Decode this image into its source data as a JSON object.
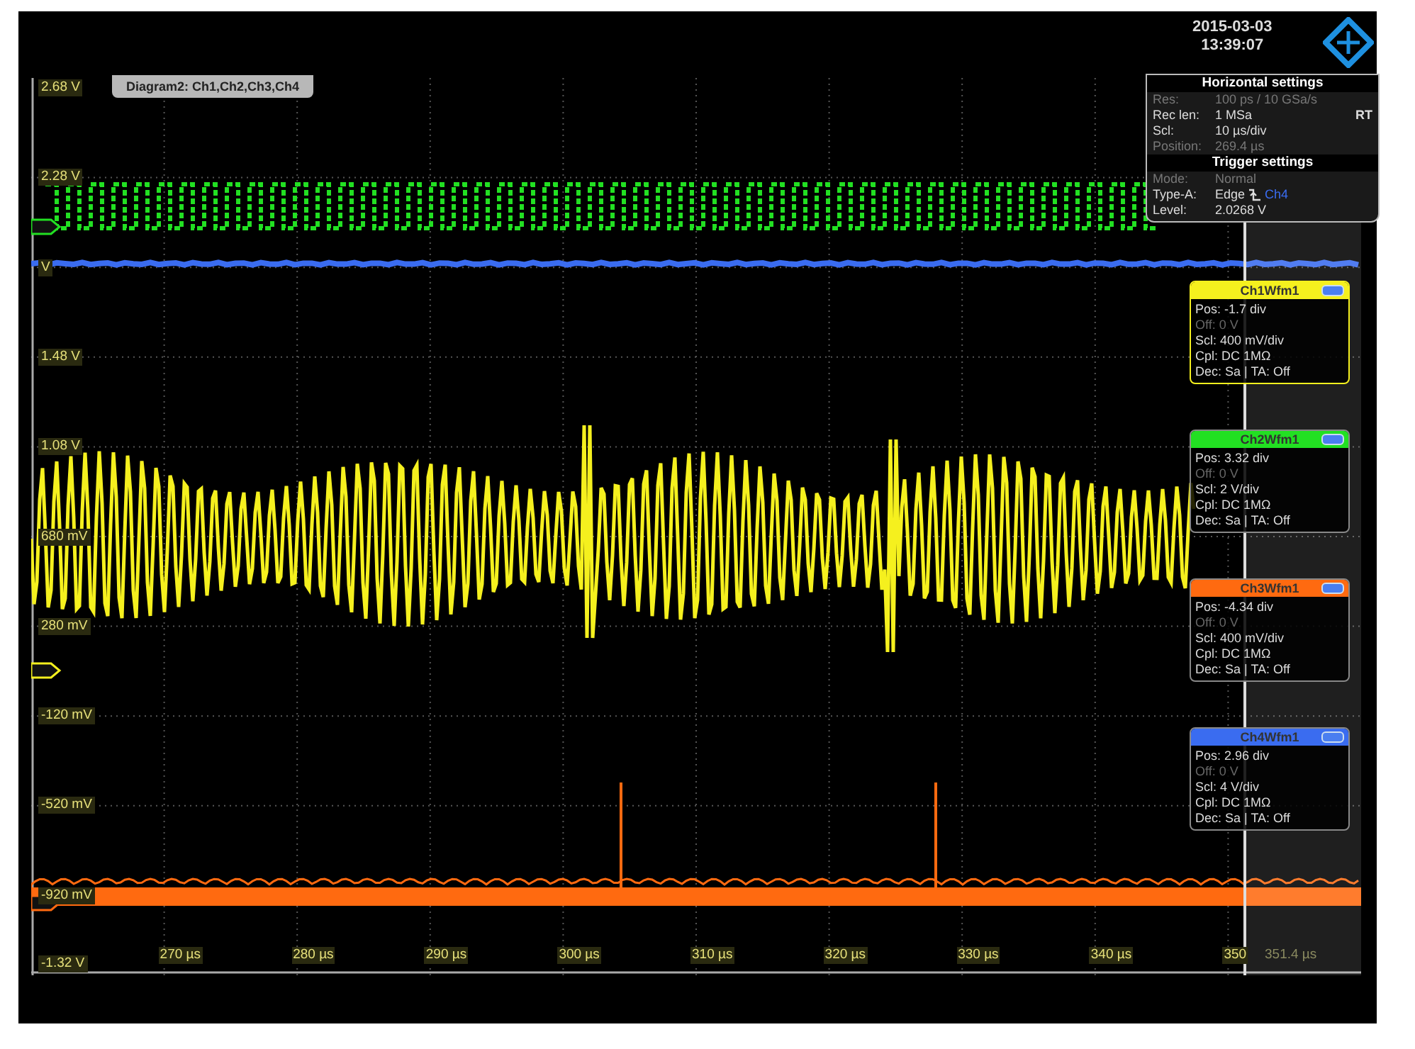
{
  "timestamp": {
    "date": "2015-03-03",
    "time": "13:39:07"
  },
  "diagram_label": "Diagram2: Ch1,Ch2,Ch3,Ch4",
  "y_axis_labels": [
    "2.68 V",
    "2.28 V",
    "V",
    "1.48 V",
    "1.08 V",
    "680 mV",
    "280 mV",
    "-120 mV",
    "-520 mV",
    "-920 mV",
    "-1.32 V"
  ],
  "x_axis_labels": [
    {
      "text": "270 µs",
      "dimmed": false
    },
    {
      "text": "280 µs",
      "dimmed": false
    },
    {
      "text": "290 µs",
      "dimmed": false
    },
    {
      "text": "300 µs",
      "dimmed": false
    },
    {
      "text": "310 µs",
      "dimmed": false
    },
    {
      "text": "320 µs",
      "dimmed": false
    },
    {
      "text": "330 µs",
      "dimmed": false
    },
    {
      "text": "340 µs",
      "dimmed": false
    },
    {
      "text": "350",
      "dimmed": false
    },
    {
      "text": "351.4 µs",
      "dimmed": true
    }
  ],
  "horizontal_settings": {
    "title": "Horizontal settings",
    "badge": "RT",
    "rows": [
      {
        "label": "Res:",
        "value": "100 ps / 10 GSa/s",
        "dimmed": true
      },
      {
        "label": "Rec len:",
        "value": "1 MSa",
        "dimmed": false
      },
      {
        "label": "Scl:",
        "value": "10 µs/div",
        "dimmed": false
      },
      {
        "label": "Position:",
        "value": "269.4 µs",
        "dimmed": true
      }
    ]
  },
  "trigger_settings": {
    "title": "Trigger settings",
    "rows": [
      {
        "label": "Mode:",
        "value": "Normal",
        "dimmed": true
      },
      {
        "label": "Type-A:",
        "value": "Edge",
        "source": "Ch4",
        "dimmed": false
      },
      {
        "label": "Level:",
        "value": "2.0268 V",
        "dimmed": false
      }
    ]
  },
  "channels": [
    {
      "name": "Ch1Wfm1",
      "color": "#f5f01e",
      "rows": [
        {
          "label": "Pos:",
          "value": "-1.7 div",
          "dimmed": false
        },
        {
          "label": "Off:",
          "value": "0 V",
          "dimmed": true
        },
        {
          "label": "Scl:",
          "value": "400 mV/div",
          "dimmed": false
        },
        {
          "label": "Cpl:",
          "value": "DC 1MΩ",
          "dimmed": false
        },
        {
          "label": "Dec:",
          "value": "Sa | TA: Off",
          "dimmed": false
        }
      ]
    },
    {
      "name": "Ch2Wfm1",
      "color": "#22e022",
      "rows": [
        {
          "label": "Pos:",
          "value": "3.32 div",
          "dimmed": false
        },
        {
          "label": "Off:",
          "value": "0 V",
          "dimmed": true
        },
        {
          "label": "Scl:",
          "value": "2 V/div",
          "dimmed": false
        },
        {
          "label": "Cpl:",
          "value": "DC 1MΩ",
          "dimmed": false
        },
        {
          "label": "Dec:",
          "value": "Sa | TA: Off",
          "dimmed": false
        }
      ]
    },
    {
      "name": "Ch3Wfm1",
      "color": "#ff6a10",
      "rows": [
        {
          "label": "Pos:",
          "value": "-4.34 div",
          "dimmed": false
        },
        {
          "label": "Off:",
          "value": "0 V",
          "dimmed": true
        },
        {
          "label": "Scl:",
          "value": "400 mV/div",
          "dimmed": false
        },
        {
          "label": "Cpl:",
          "value": "DC 1MΩ",
          "dimmed": false
        },
        {
          "label": "Dec:",
          "value": "Sa | TA: Off",
          "dimmed": false
        }
      ]
    },
    {
      "name": "Ch4Wfm1",
      "color": "#3a6cf0",
      "rows": [
        {
          "label": "Pos:",
          "value": "2.96 div",
          "dimmed": false
        },
        {
          "label": "Off:",
          "value": "0 V",
          "dimmed": true
        },
        {
          "label": "Scl:",
          "value": "4 V/div",
          "dimmed": false
        },
        {
          "label": "Cpl:",
          "value": "DC 1MΩ",
          "dimmed": false
        },
        {
          "label": "Dec:",
          "value": "Sa | TA: Off",
          "dimmed": false
        }
      ]
    }
  ]
}
